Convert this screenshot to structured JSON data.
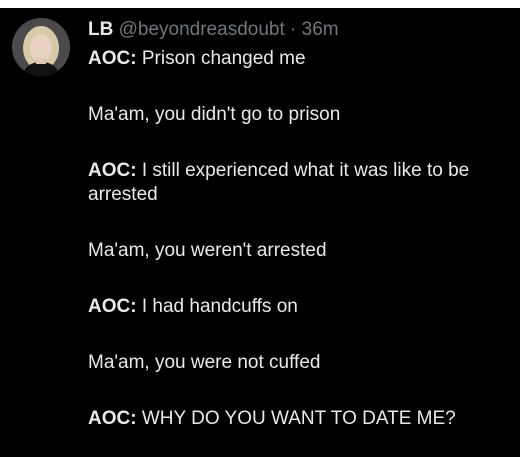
{
  "tweet": {
    "author_name": "LB",
    "handle": "@beyondreasdoubt",
    "separator": "·",
    "time": "36m",
    "lines": [
      {
        "speaker": "AOC",
        "text": " Prison changed me"
      },
      {
        "speaker": "",
        "text": "Ma'am, you didn't go to prison"
      },
      {
        "speaker": "AOC",
        "text": " I still experienced what it was like to be arrested"
      },
      {
        "speaker": "",
        "text": "Ma'am, you weren't arrested"
      },
      {
        "speaker": "AOC",
        "text": " I had handcuffs on"
      },
      {
        "speaker": "",
        "text": "Ma'am, you were not cuffed"
      },
      {
        "speaker": "AOC",
        "text": " WHY DO YOU WANT TO DATE ME?"
      }
    ]
  },
  "colors": {
    "background": "#000000",
    "text": "#e7e9ea",
    "muted": "#71767b"
  },
  "icons": {
    "avatar": "profile-photo"
  }
}
